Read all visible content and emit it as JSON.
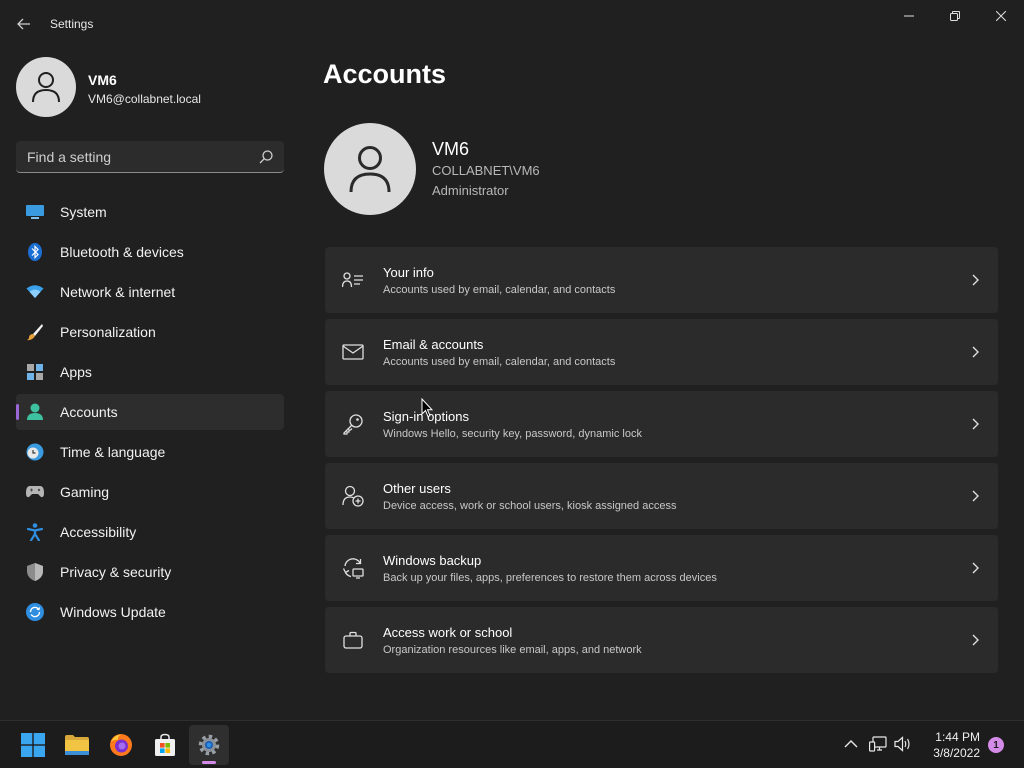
{
  "app": {
    "title": "Settings",
    "back_icon": "back-arrow-icon"
  },
  "window_controls": [
    "minimize-icon",
    "restore-icon",
    "close-icon"
  ],
  "sidebar": {
    "profile": {
      "name": "VM6",
      "email": "VM6@collabnet.local"
    },
    "search": {
      "placeholder": "Find a setting"
    },
    "items": [
      {
        "label": "System",
        "icon": "system-display-icon"
      },
      {
        "label": "Bluetooth & devices",
        "icon": "bluetooth-icon"
      },
      {
        "label": "Network & internet",
        "icon": "wifi-icon"
      },
      {
        "label": "Personalization",
        "icon": "brush-icon"
      },
      {
        "label": "Apps",
        "icon": "apps-icon"
      },
      {
        "label": "Accounts",
        "icon": "accounts-icon",
        "active": true
      },
      {
        "label": "Time & language",
        "icon": "clock-globe-icon"
      },
      {
        "label": "Gaming",
        "icon": "gamepad-icon"
      },
      {
        "label": "Accessibility",
        "icon": "accessibility-icon"
      },
      {
        "label": "Privacy & security",
        "icon": "shield-icon"
      },
      {
        "label": "Windows Update",
        "icon": "update-icon"
      }
    ]
  },
  "main": {
    "title": "Accounts",
    "user": {
      "name": "VM6",
      "domain": "COLLABNET\\VM6",
      "role": "Administrator"
    },
    "cards": [
      {
        "title": "Your info",
        "desc": "Accounts used by email, calendar, and contacts",
        "icon": "person-info-icon"
      },
      {
        "title": "Email & accounts",
        "desc": "Accounts used by email, calendar, and contacts",
        "icon": "mail-icon"
      },
      {
        "title": "Sign-in options",
        "desc": "Windows Hello, security key, password, dynamic lock",
        "icon": "key-icon"
      },
      {
        "title": "Other users",
        "desc": "Device access, work or school users, kiosk assigned access",
        "icon": "add-person-icon"
      },
      {
        "title": "Windows backup",
        "desc": "Back up your files, apps, preferences to restore them across devices",
        "icon": "backup-sync-icon"
      },
      {
        "title": "Access work or school",
        "desc": "Organization resources like email, apps, and network",
        "icon": "briefcase-icon"
      }
    ]
  },
  "taskbar": {
    "apps": [
      {
        "name": "start-button",
        "icon": "windows-logo-icon"
      },
      {
        "name": "file-explorer",
        "icon": "folder-icon"
      },
      {
        "name": "firefox",
        "icon": "firefox-icon"
      },
      {
        "name": "microsoft-store",
        "icon": "store-icon"
      },
      {
        "name": "settings",
        "icon": "gear-icon",
        "active": true
      }
    ],
    "tray": [
      "chevron-up-icon",
      "network-icon",
      "volume-icon"
    ],
    "time": "1:44 PM",
    "date": "3/8/2022",
    "notification_count": "1"
  },
  "colors": {
    "background": "#202020",
    "card": "#2b2b2b",
    "accent": "#9b66d6",
    "badge": "#d48be8"
  }
}
